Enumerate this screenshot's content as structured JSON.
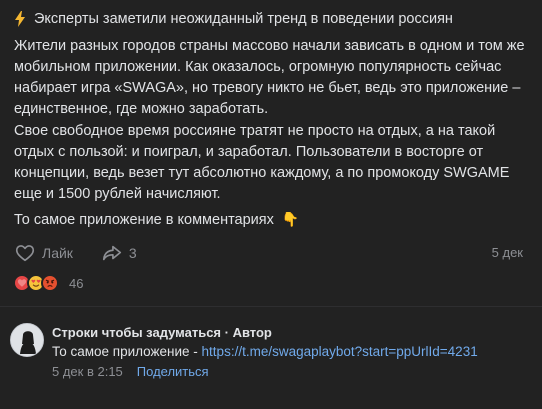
{
  "post": {
    "title": "Эксперты заметили неожиданный тренд в поведении россиян",
    "paragraph1": "Жители разных городов страны массово начали зависать в одном и том же мобильном приложении. Как оказалось, огромную популярность сейчас набирает игра «SWAGA», но тревогу никто не бьет, ведь это приложение – единственное, где можно заработать.",
    "paragraph2": "Свое свободное время россияне тратят не просто на отдых, а на такой отдых с пользой: и поиграл, и заработал. Пользователи в восторге от концепции, ведь везет тут абсолютно каждому, а по промокоду SWGAME еще и 1500 рублей начисляют.",
    "paragraph3": "То самое приложение в комментариях",
    "like_label": "Лайк",
    "share_count": "3",
    "date": "5 дек",
    "reaction_count": "46"
  },
  "comment": {
    "author": "Строки чтобы задуматься · Автор",
    "text": "То самое приложение - ",
    "link": "https://t.me/swagaplaybot?start=ppUrlId=4231",
    "date": "5 дек в 2:15",
    "share_label": "Поделиться"
  },
  "icons": {
    "title": "lightning-icon",
    "like": "heart-outline-icon",
    "share": "share-arrow-icon",
    "pointing": "pointing-down-hand-emoji",
    "reactions": [
      "heart-emoji",
      "heart-eyes-emoji",
      "angry-face-emoji"
    ]
  },
  "colors": {
    "background": "#19191a",
    "card": "#222222",
    "text": "#e1e3e6",
    "muted": "#8d8f94",
    "link": "#71aaeb",
    "bolt": "#f5b731"
  }
}
